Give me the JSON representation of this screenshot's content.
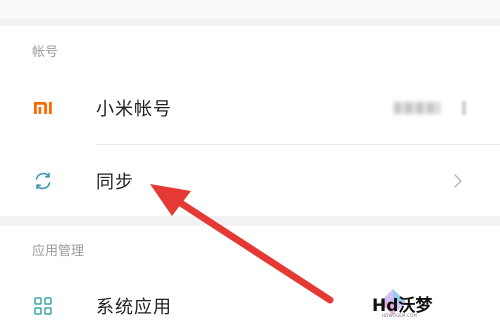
{
  "sections": {
    "account": {
      "header": "帐号",
      "items": [
        {
          "label": "小米帐号",
          "icon": "mi-logo-icon",
          "value": "blurred"
        },
        {
          "label": "同步",
          "icon": "sync-icon"
        }
      ]
    },
    "apps": {
      "header": "应用管理",
      "items": [
        {
          "label": "系统应用",
          "icon": "apps-grid-icon"
        }
      ]
    }
  },
  "annotation": {
    "type": "arrow",
    "color": "#e53935"
  },
  "watermark": {
    "text": "Hd沃梦",
    "subtext": "HDWOGEM.COM"
  },
  "colors": {
    "background": "#f2f2f2",
    "card": "#ffffff",
    "mi_orange": "#ff6900",
    "sync_blue": "#3f93b5",
    "grid_teal": "#3aa5a6"
  }
}
